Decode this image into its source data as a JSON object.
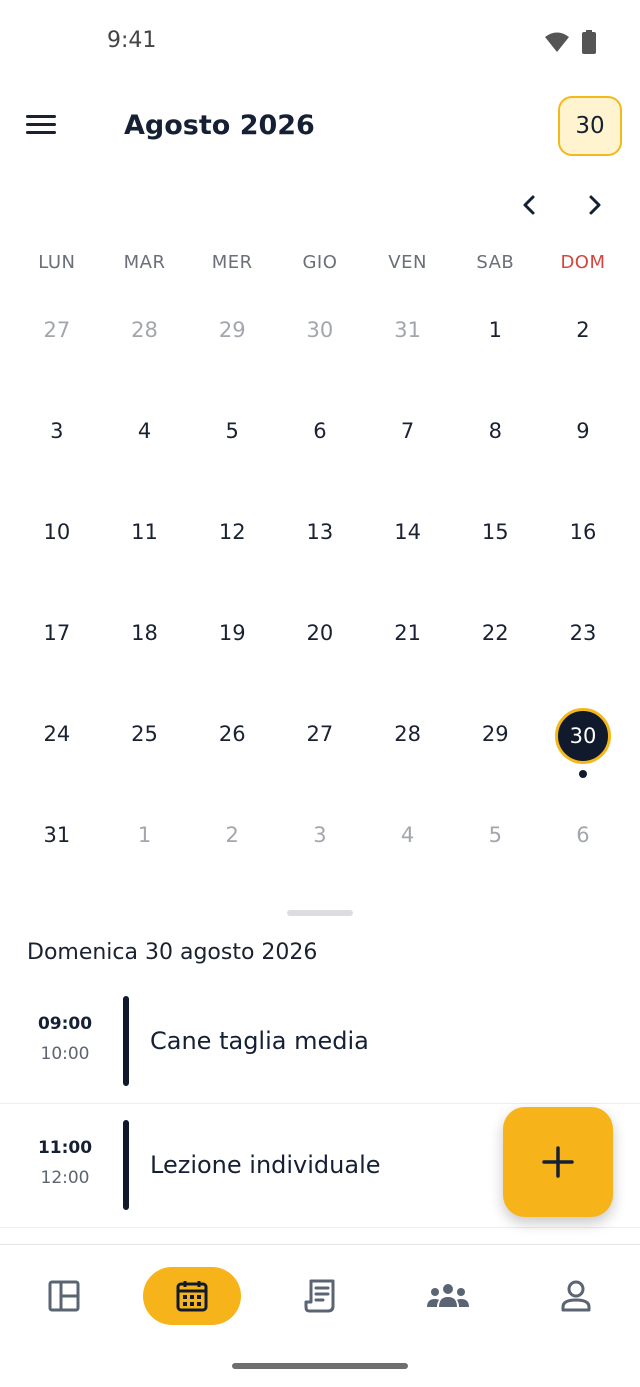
{
  "status_bar": {
    "time": "9:41"
  },
  "header": {
    "month_title": "Agosto 2026",
    "today_label": "30"
  },
  "weekdays": [
    "LUN",
    "MAR",
    "MER",
    "GIO",
    "VEN",
    "SAB",
    "DOM"
  ],
  "weeks": [
    [
      {
        "d": "27",
        "out": true
      },
      {
        "d": "28",
        "out": true
      },
      {
        "d": "29",
        "out": true
      },
      {
        "d": "30",
        "out": true
      },
      {
        "d": "31",
        "out": true
      },
      {
        "d": "1"
      },
      {
        "d": "2"
      }
    ],
    [
      {
        "d": "3"
      },
      {
        "d": "4"
      },
      {
        "d": "5"
      },
      {
        "d": "6"
      },
      {
        "d": "7"
      },
      {
        "d": "8"
      },
      {
        "d": "9"
      }
    ],
    [
      {
        "d": "10"
      },
      {
        "d": "11"
      },
      {
        "d": "12"
      },
      {
        "d": "13"
      },
      {
        "d": "14"
      },
      {
        "d": "15"
      },
      {
        "d": "16"
      }
    ],
    [
      {
        "d": "17"
      },
      {
        "d": "18"
      },
      {
        "d": "19"
      },
      {
        "d": "20"
      },
      {
        "d": "21"
      },
      {
        "d": "22"
      },
      {
        "d": "23"
      }
    ],
    [
      {
        "d": "24"
      },
      {
        "d": "25"
      },
      {
        "d": "26"
      },
      {
        "d": "27"
      },
      {
        "d": "28"
      },
      {
        "d": "29"
      },
      {
        "d": "30",
        "selected": true,
        "has_event": true
      }
    ],
    [
      {
        "d": "31"
      },
      {
        "d": "1",
        "out": true
      },
      {
        "d": "2",
        "out": true
      },
      {
        "d": "3",
        "out": true
      },
      {
        "d": "4",
        "out": true
      },
      {
        "d": "5",
        "out": true
      },
      {
        "d": "6",
        "out": true
      }
    ]
  ],
  "selected_date_label": "Domenica 30 agosto 2026",
  "events": [
    {
      "start": "09:00",
      "end": "10:00",
      "title": "Cane taglia media"
    },
    {
      "start": "11:00",
      "end": "12:00",
      "title": "Lezione individuale"
    }
  ],
  "bottom_nav": [
    {
      "icon": "dashboard-icon",
      "active": false
    },
    {
      "icon": "calendar-icon",
      "active": true
    },
    {
      "icon": "receipt-icon",
      "active": false
    },
    {
      "icon": "group-icon",
      "active": false
    },
    {
      "icon": "profile-icon",
      "active": false
    }
  ],
  "colors": {
    "accent": "#f6b41a",
    "dark": "#111a2c",
    "sunday": "#d2463f"
  }
}
